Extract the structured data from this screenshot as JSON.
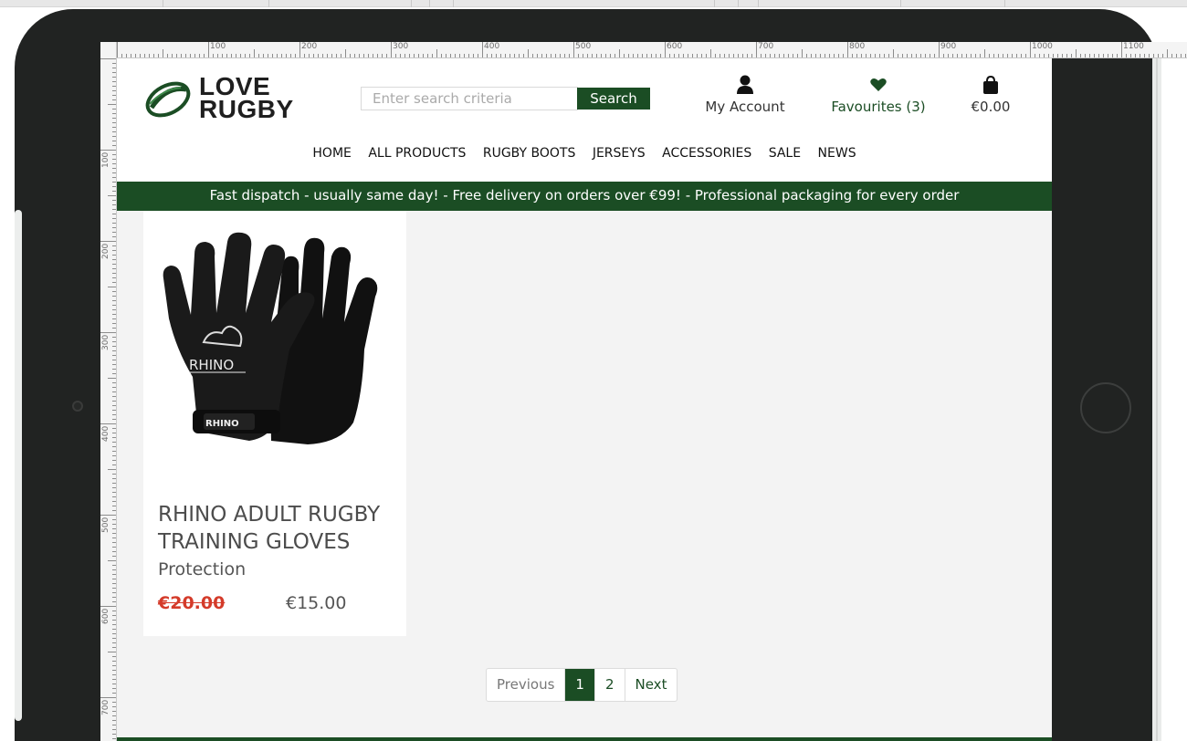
{
  "site": {
    "logo_line1": "LOVE",
    "logo_line2": "RUGBY"
  },
  "search": {
    "placeholder": "Enter search criteria",
    "button_label": "Search"
  },
  "header": {
    "account_label": "My Account",
    "favourites_label": "Favourites (3)",
    "cart_total": "€0.00"
  },
  "nav": {
    "items": [
      "HOME",
      "ALL PRODUCTS",
      "RUGBY BOOTS",
      "JERSEYS",
      "ACCESSORIES",
      "SALE",
      "NEWS"
    ]
  },
  "banner": {
    "text": "Fast dispatch - usually same day! - Free delivery on orders over €99! - Professional packaging for every order"
  },
  "product": {
    "title": "RHINO ADULT RUGBY TRAINING GLOVES",
    "category": "Protection",
    "old_price": "€20.00",
    "new_price": "€15.00",
    "brand_mark": "RHINO"
  },
  "pagination": {
    "previous": "Previous",
    "pages": [
      "1",
      "2"
    ],
    "next": "Next"
  },
  "ruler": {
    "top_labels": [
      "100",
      "200",
      "300",
      "400",
      "500",
      "600",
      "700",
      "800",
      "900",
      "1000",
      "1100"
    ],
    "left_labels": [
      "100",
      "200",
      "300",
      "400",
      "500",
      "600",
      "700"
    ]
  },
  "colors": {
    "brand_green": "#1b4d24",
    "sale_red": "#d43b2a",
    "tablet_frame": "#212322"
  }
}
